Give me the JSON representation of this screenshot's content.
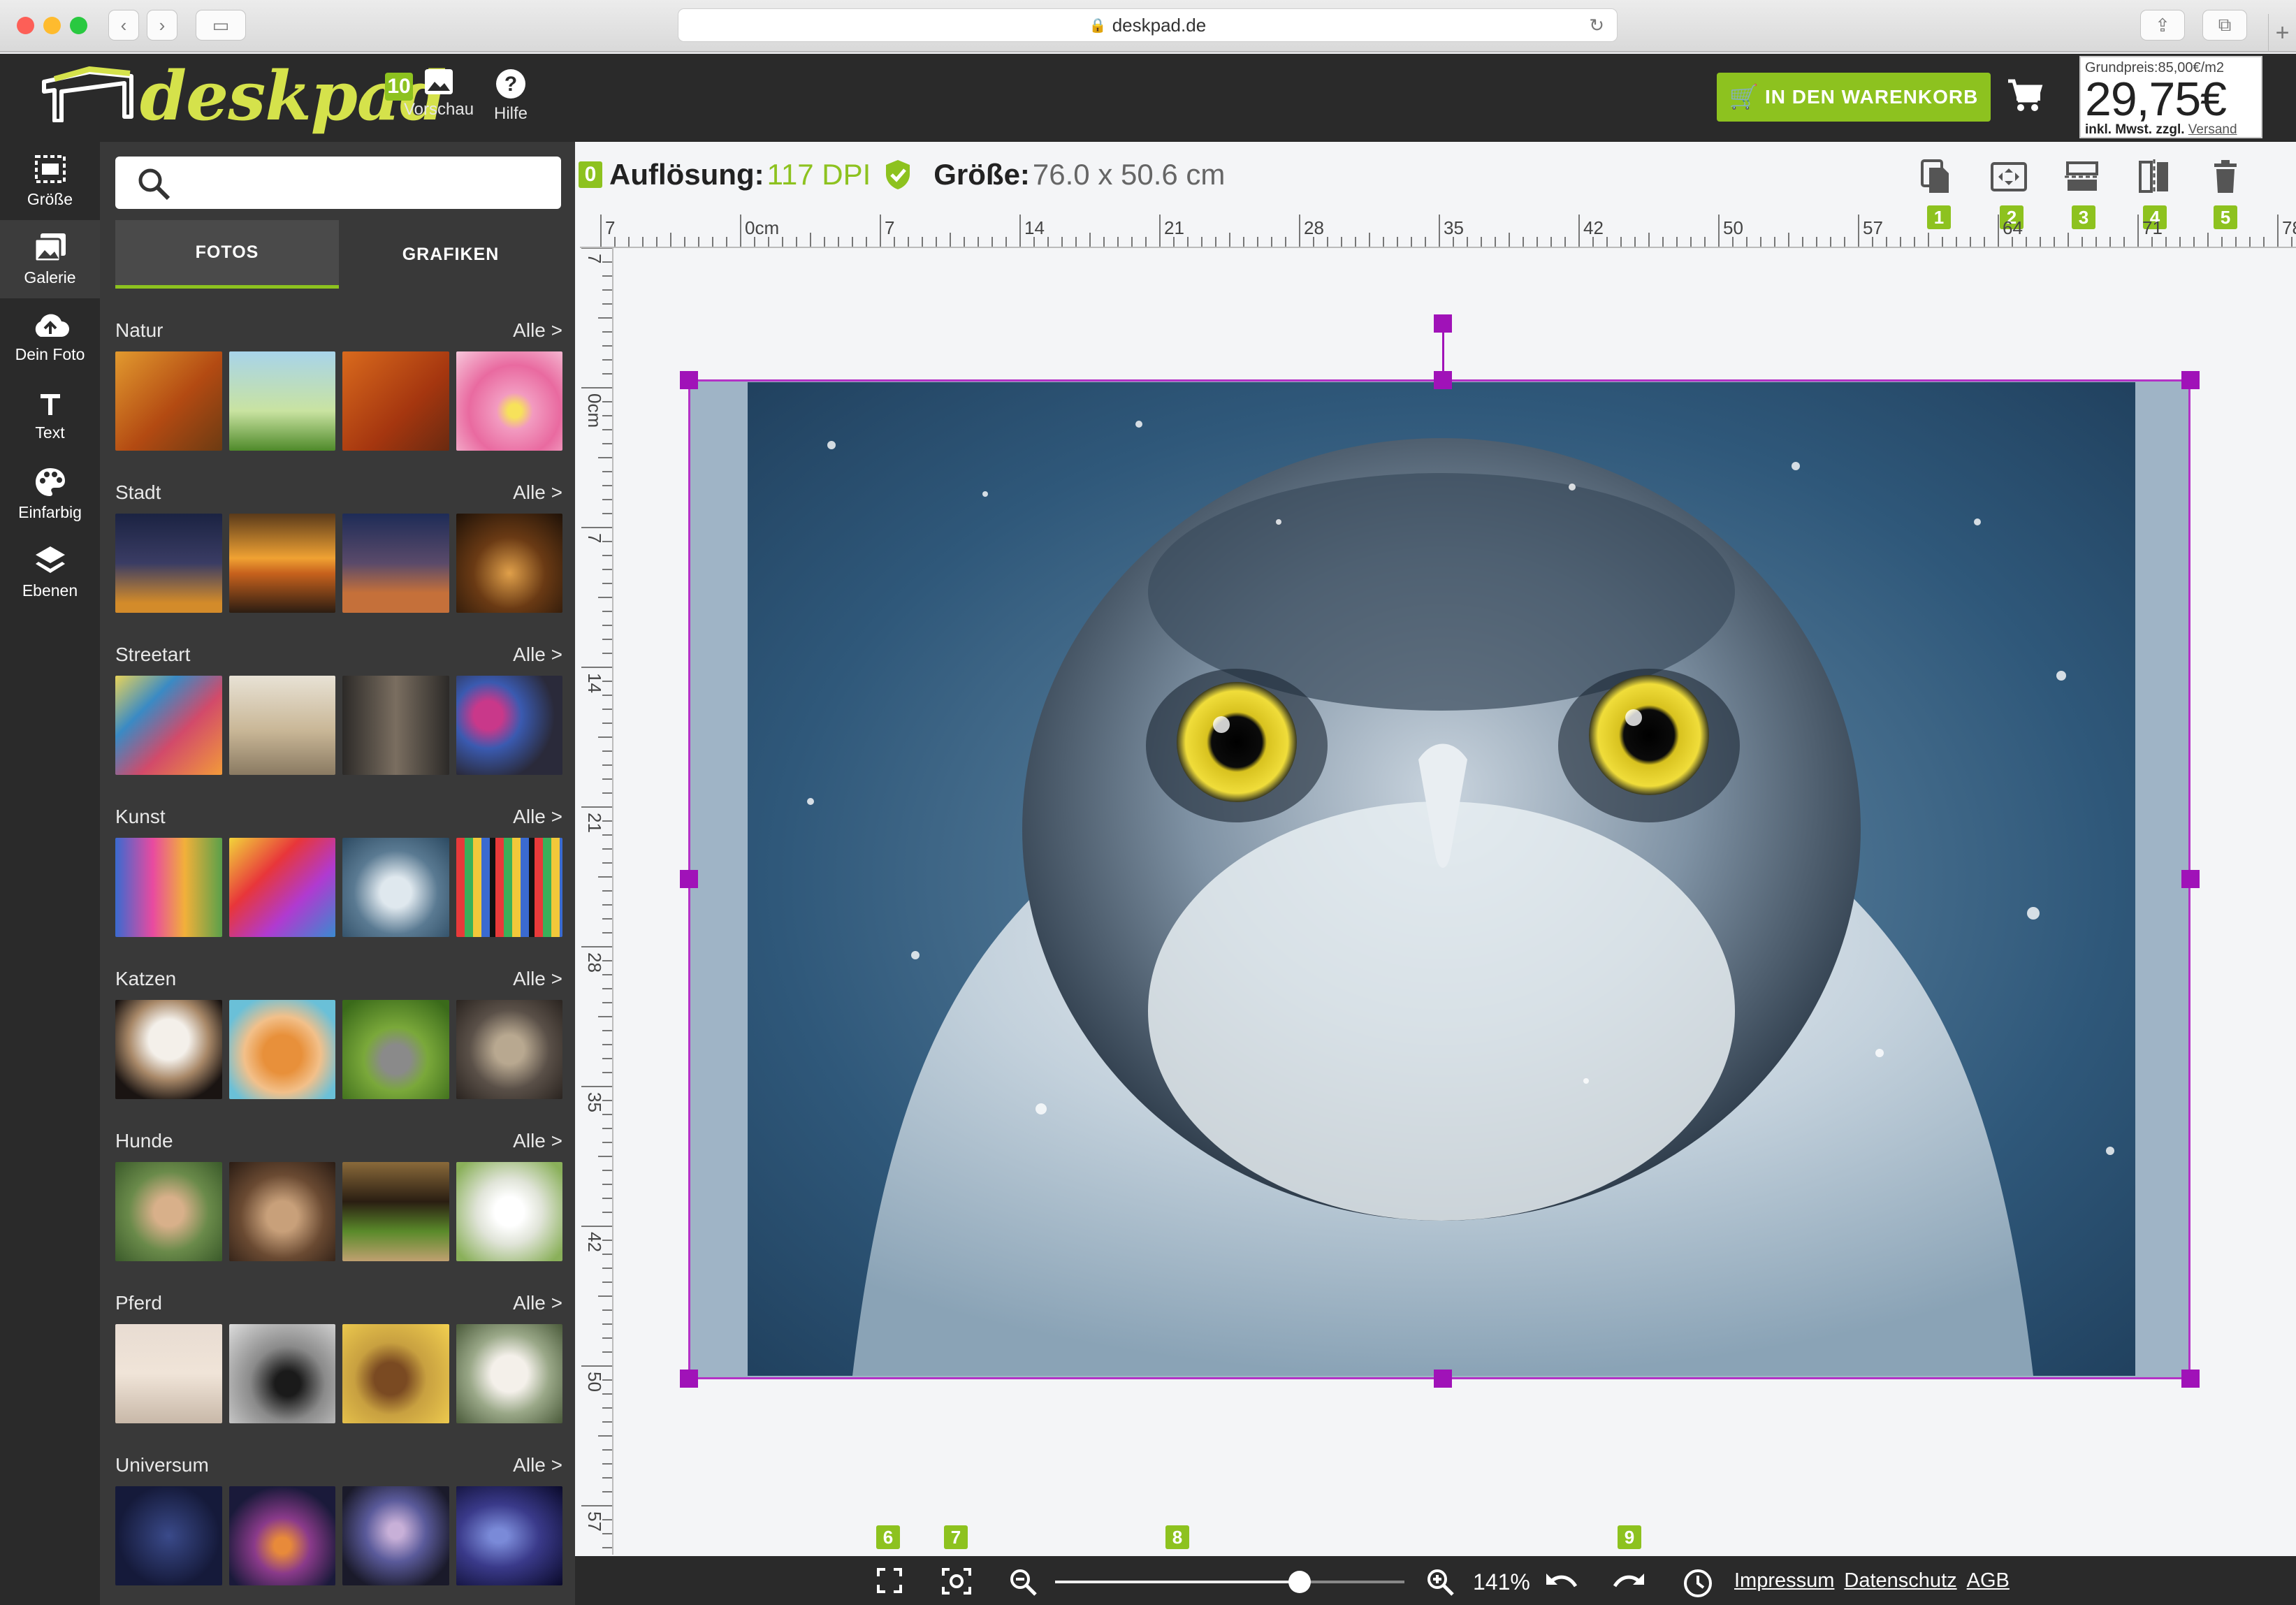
{
  "browser": {
    "url": "deskpad.de"
  },
  "header": {
    "logo_text": "deskpad",
    "preview_badge": "10",
    "preview_label": "Vorschau",
    "help_label": "Hilfe",
    "cart_button_label": "IN DEN WARENKORB",
    "price_base": "Grundpreis:85,00€/m2",
    "price": "29,75€",
    "price_tax_note": "inkl. Mwst. zzgl.",
    "price_shipping_link": "Versand"
  },
  "sidebar": {
    "items": [
      {
        "label": "Größe",
        "icon": "size-icon"
      },
      {
        "label": "Galerie",
        "icon": "gallery-icon",
        "active": true
      },
      {
        "label": "Dein Foto",
        "icon": "upload-icon"
      },
      {
        "label": "Text",
        "icon": "text-icon"
      },
      {
        "label": "Einfarbig",
        "icon": "palette-icon"
      },
      {
        "label": "Ebenen",
        "icon": "layers-icon"
      }
    ]
  },
  "gallery": {
    "search_placeholder": "",
    "tabs": [
      {
        "label": "FOTOS",
        "active": true
      },
      {
        "label": "GRAFIKEN"
      }
    ],
    "all_label": "Alle >",
    "categories": [
      {
        "name": "Natur"
      },
      {
        "name": "Stadt"
      },
      {
        "name": "Streetart"
      },
      {
        "name": "Kunst"
      },
      {
        "name": "Katzen"
      },
      {
        "name": "Hunde"
      },
      {
        "name": "Pferd"
      },
      {
        "name": "Universum"
      }
    ]
  },
  "infobar": {
    "badge": "0",
    "resolution_label": "Auflösung:",
    "resolution_value": "117 DPI",
    "size_label": "Größe:",
    "size_value": "76.0 x 50.6 cm"
  },
  "toolbar": {
    "badges": [
      "1",
      "2",
      "3",
      "4",
      "5"
    ],
    "bottom_badges": [
      "6",
      "7",
      "8",
      "9"
    ]
  },
  "rulers": {
    "horizontal": [
      "7",
      "0cm",
      "7",
      "14",
      "21",
      "28",
      "35",
      "42",
      "50",
      "57",
      "64",
      "71",
      "78"
    ],
    "vertical": [
      "7",
      "0cm",
      "7",
      "14",
      "21",
      "28",
      "35",
      "42",
      "50",
      "57"
    ]
  },
  "bottombar": {
    "zoom_value": "141%",
    "zoom_level": 0.7,
    "links": [
      "Impressum",
      "Datenschutz",
      "AGB"
    ]
  },
  "colors": {
    "accent": "#8dc21f",
    "handle": "#a012b8",
    "dark": "#2a2a2a"
  }
}
